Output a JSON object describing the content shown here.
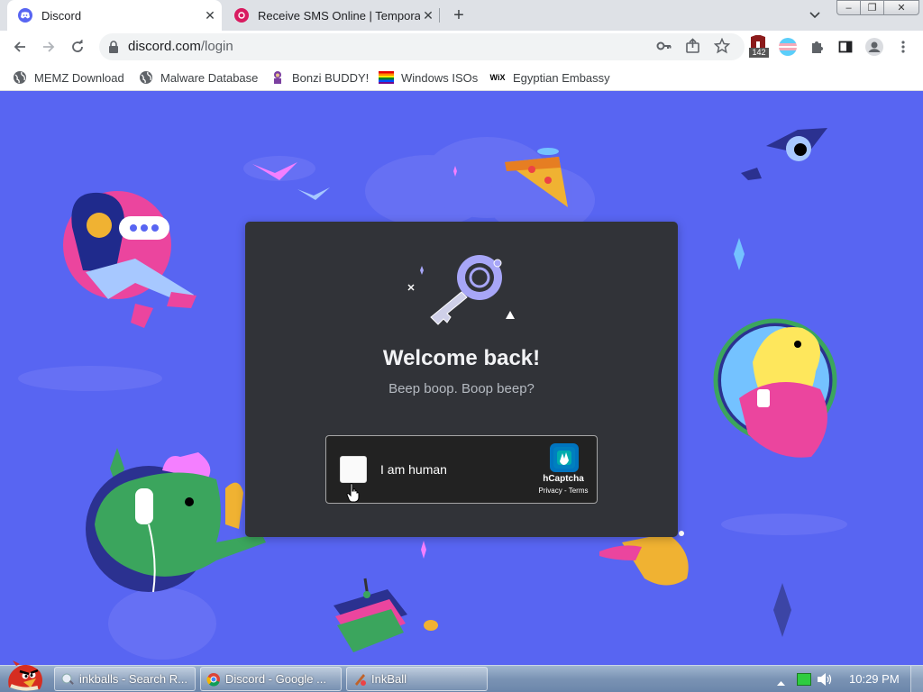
{
  "tabs": [
    {
      "title": "Discord",
      "icon": "discord-icon",
      "active": true
    },
    {
      "title": "Receive SMS Online | Tempora",
      "icon": "sms-site-icon",
      "active": false
    }
  ],
  "window_controls": {
    "minimize": "‒",
    "maximize": "❐",
    "close": "✕"
  },
  "toolbar": {
    "url_host": "discord.com",
    "url_path": "/login",
    "extension_badge": "142"
  },
  "bookmarks": [
    {
      "label": "MEMZ Download",
      "icon": "globe-icon"
    },
    {
      "label": "Malware Database",
      "icon": "globe-icon"
    },
    {
      "label": "Bonzi BUDDY!",
      "icon": "bonzi-icon"
    },
    {
      "label": "Windows ISOs",
      "icon": "rainbow-flag-icon"
    },
    {
      "label": "Egyptian Embassy",
      "icon": "wix-icon"
    }
  ],
  "login_card": {
    "title": "Welcome back!",
    "subtitle": "Beep boop. Boop beep?"
  },
  "captcha": {
    "label": "I am human",
    "provider": "hCaptcha",
    "privacy": "Privacy",
    "separator": "-",
    "terms": "Terms"
  },
  "taskbar": {
    "tasks": [
      {
        "label": "inkballs - Search R...",
        "icon": "search-icon"
      },
      {
        "label": "Discord - Google ...",
        "icon": "chrome-icon"
      },
      {
        "label": "InkBall",
        "icon": "inkball-icon"
      }
    ],
    "clock": "10:29 PM"
  },
  "colors": {
    "discord_blurple": "#5865f2",
    "card_background": "#313338",
    "captcha_background": "#222222",
    "chrome_tabstrip": "#dee1e6"
  }
}
